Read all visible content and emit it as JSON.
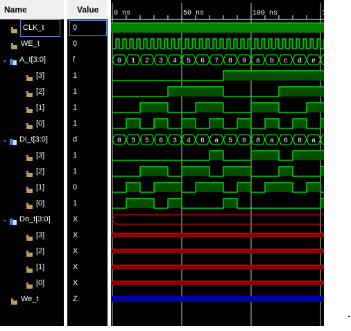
{
  "columns": {
    "name": "Name",
    "value": "Value"
  },
  "timeline": {
    "ticks": [
      "0 ns",
      "50 ns",
      "100 ns",
      "1"
    ]
  },
  "signals": [
    {
      "name": "CLK_t",
      "value": "0",
      "kind": "bit",
      "indent": 1,
      "selected": true
    },
    {
      "name": "WE_t",
      "value": "0",
      "kind": "bit",
      "indent": 1
    },
    {
      "name": "A_t[3:0]",
      "value": "f",
      "kind": "bus",
      "indent": 0,
      "expanded": true
    },
    {
      "name": "[3]",
      "value": "1",
      "kind": "bit",
      "indent": 2
    },
    {
      "name": "[2]",
      "value": "1",
      "kind": "bit",
      "indent": 2
    },
    {
      "name": "[1]",
      "value": "1",
      "kind": "bit",
      "indent": 2
    },
    {
      "name": "[0]",
      "value": "1",
      "kind": "bit",
      "indent": 2
    },
    {
      "name": "Di_t[3:0]",
      "value": "d",
      "kind": "bus",
      "indent": 0,
      "expanded": true
    },
    {
      "name": "[3]",
      "value": "1",
      "kind": "bit",
      "indent": 2
    },
    {
      "name": "[2]",
      "value": "1",
      "kind": "bit",
      "indent": 2
    },
    {
      "name": "[1]",
      "value": "0",
      "kind": "bit",
      "indent": 2
    },
    {
      "name": "[0]",
      "value": "1",
      "kind": "bit",
      "indent": 2
    },
    {
      "name": "Do_t[3:0]",
      "value": "X",
      "kind": "bus",
      "indent": 0,
      "expanded": true
    },
    {
      "name": "[3]",
      "value": "X",
      "kind": "bit",
      "indent": 2
    },
    {
      "name": "[2]",
      "value": "X",
      "kind": "bit",
      "indent": 2
    },
    {
      "name": "[1]",
      "value": "X",
      "kind": "bit",
      "indent": 2
    },
    {
      "name": "[0]",
      "value": "X",
      "kind": "bit",
      "indent": 2
    },
    {
      "name": "We_t",
      "value": "Z",
      "kind": "bit",
      "indent": 1
    }
  ],
  "bus_labels": {
    "A_t": [
      "0",
      "1",
      "2",
      "3",
      "4",
      "5",
      "6",
      "7",
      "8",
      "9",
      "a",
      "b",
      "c",
      "d",
      "e"
    ],
    "Di_t": [
      "0",
      "3",
      "5",
      "6",
      "3",
      "4",
      "6",
      "a",
      "5",
      "6",
      "8",
      "a",
      "6",
      "8",
      "a"
    ]
  },
  "colors": {
    "wave": "#00ff00",
    "undefined": "#ff0000",
    "highz": "#0000ff",
    "cursor": "#ffffff"
  }
}
